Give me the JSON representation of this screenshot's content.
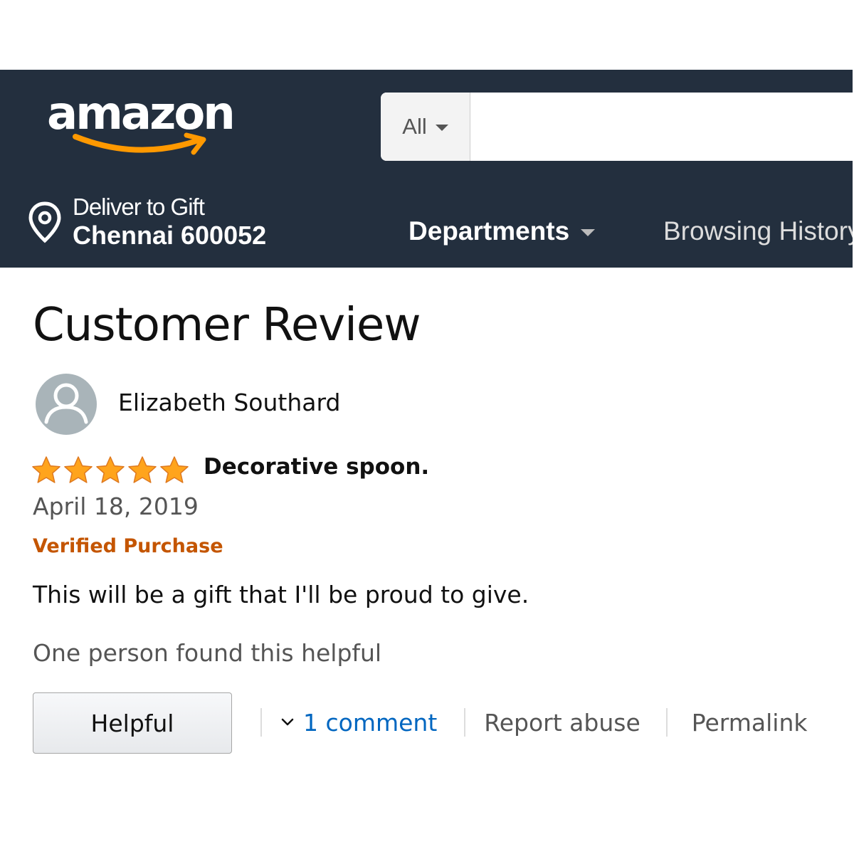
{
  "header": {
    "logo_text": "amazon",
    "search": {
      "scope_label": "All",
      "placeholder": "",
      "value": ""
    },
    "deliver": {
      "line1": "Deliver to Gift",
      "line2": "Chennai 600052"
    },
    "nav": {
      "departments_label": "Departments",
      "browsing_history_label": "Browsing History"
    }
  },
  "review": {
    "page_title": "Customer Review",
    "reviewer_name": "Elizabeth Southard",
    "rating": 5,
    "rating_max": 5,
    "title": "Decorative spoon.",
    "date": "April 18, 2019",
    "verified_label": "Verified Purchase",
    "body": "This will be a gift that I'll be proud to give.",
    "helpful_count_text": "One person found this helpful",
    "actions": {
      "helpful_button_label": "Helpful",
      "comment_link_label": "1 comment",
      "report_abuse_label": "Report abuse",
      "permalink_label": "Permalink"
    }
  },
  "colors": {
    "header_bg": "#232f3e",
    "smile": "#ff9900",
    "star": "#ffa41c",
    "verified": "#c45500",
    "link": "#0066c0"
  },
  "icons": [
    "amazon-smile-icon",
    "caret-down-icon",
    "location-pin-icon",
    "user-avatar-icon",
    "star-icon",
    "chevron-down-icon"
  ]
}
